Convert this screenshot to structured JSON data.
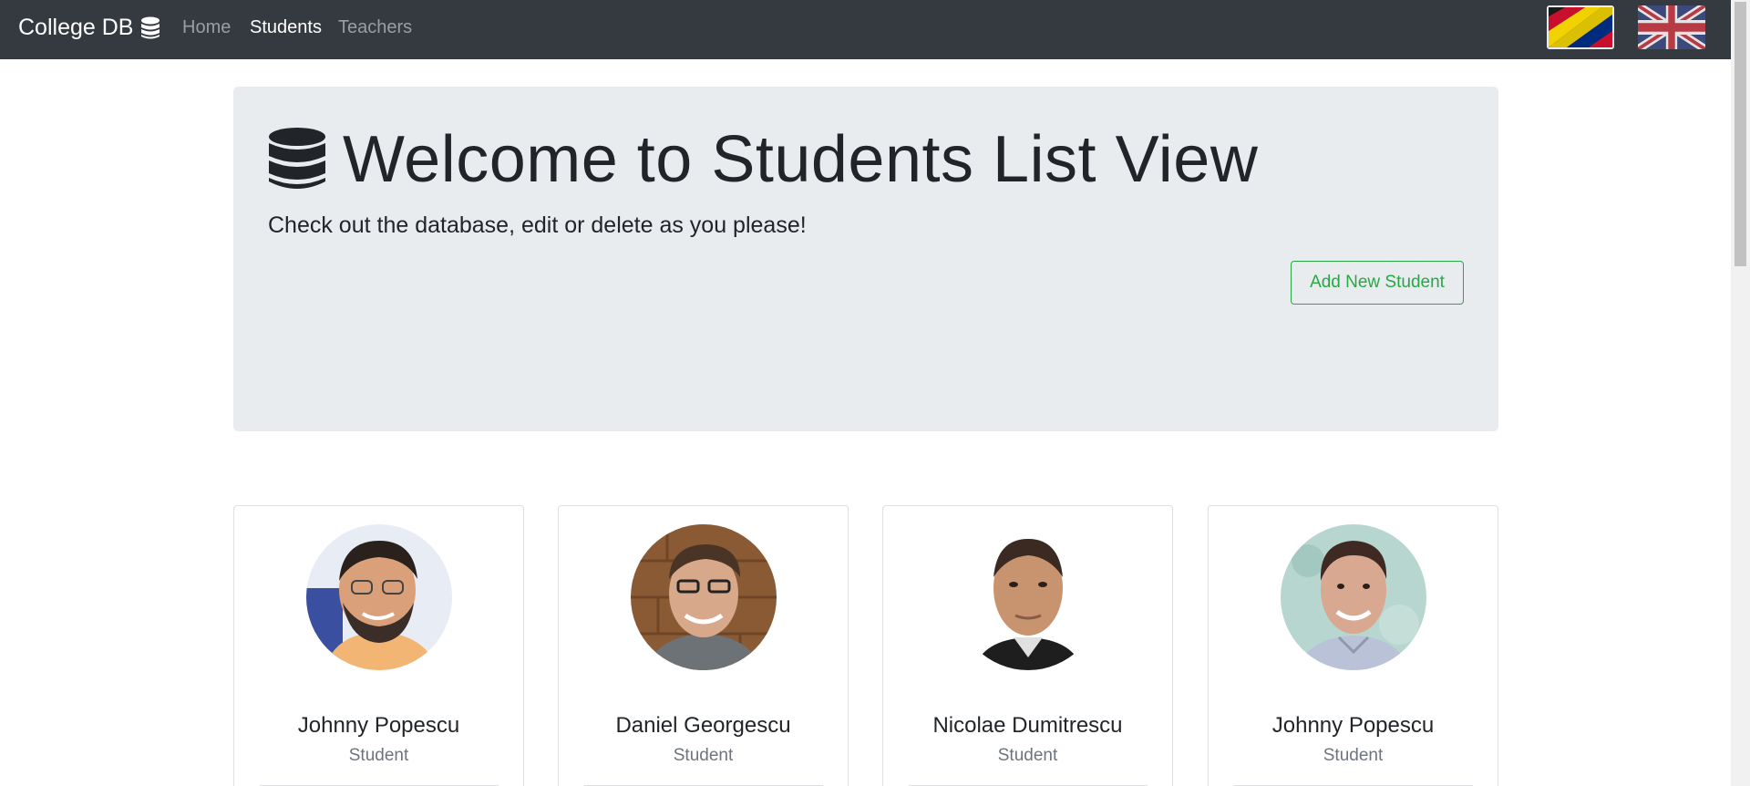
{
  "navbar": {
    "brand": "College DB",
    "links": [
      {
        "label": "Home",
        "active": false
      },
      {
        "label": "Students",
        "active": true
      },
      {
        "label": "Teachers",
        "active": false
      }
    ],
    "flags": [
      "romanian-flag",
      "uk-flag"
    ]
  },
  "jumbotron": {
    "title": "Welcome to Students List View",
    "lead": "Check out the database, edit or delete as you please!",
    "add_button": "Add New Student"
  },
  "students": [
    {
      "name": "Johnny Popescu",
      "role": "Student"
    },
    {
      "name": "Daniel Georgescu",
      "role": "Student"
    },
    {
      "name": "Nicolae Dumitrescu",
      "role": "Student"
    },
    {
      "name": "Johnny Popescu",
      "role": "Student"
    }
  ],
  "colors": {
    "navbar_bg": "#343a40",
    "jumbotron_bg": "#e9ecef",
    "success": "#28a745",
    "muted": "#6c757d"
  }
}
